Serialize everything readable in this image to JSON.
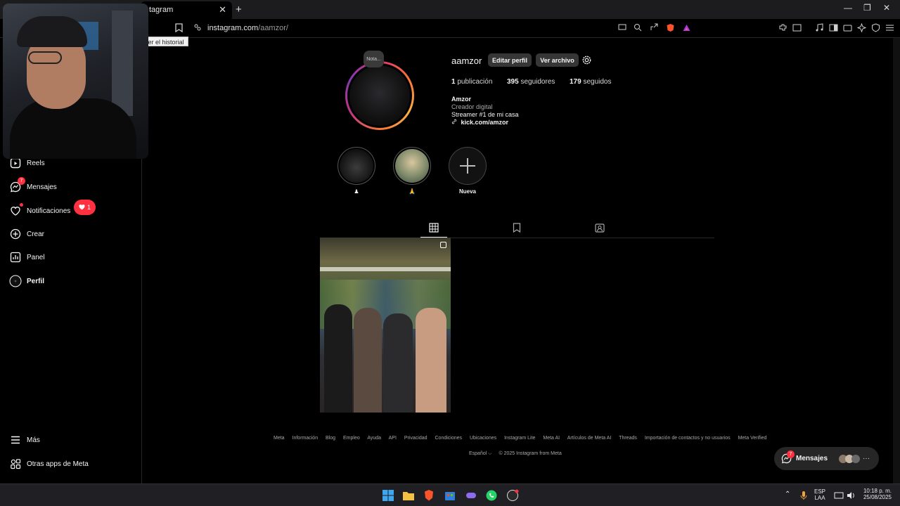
{
  "browser": {
    "tab_title": "tagram",
    "tab_close": "✕",
    "new_tab": "+",
    "url_host": "instagram.com",
    "url_path": "/aamzor/",
    "tooltip": "ver el historial",
    "window_controls": [
      "—",
      "❐",
      "✕"
    ]
  },
  "sidebar": {
    "items": [
      {
        "label": "Reels",
        "icon": "reels-icon"
      },
      {
        "label": "Mensajes",
        "icon": "messenger-icon",
        "badge": "7"
      },
      {
        "label": "Notificaciones",
        "icon": "heart-icon",
        "badge_count": "1"
      },
      {
        "label": "Crear",
        "icon": "plus-square-icon"
      },
      {
        "label": "Panel",
        "icon": "chart-icon"
      },
      {
        "label": "Perfil",
        "icon": "avatar-icon"
      },
      {
        "label": "Más",
        "icon": "menu-icon"
      },
      {
        "label": "Otras apps de Meta",
        "icon": "meta-apps-icon"
      }
    ]
  },
  "profile": {
    "note": "Nota...",
    "username": "aamzor",
    "edit_button": "Editar perfil",
    "archive_button": "Ver archivo",
    "stats": [
      {
        "count": "1",
        "label": "publicación"
      },
      {
        "count": "395",
        "label": "seguidores"
      },
      {
        "count": "179",
        "label": "seguidos"
      }
    ],
    "bio_name": "Amzor",
    "bio_category": "Creador digital",
    "bio_text": "Streamer #1 de mi casa",
    "bio_link": "kick.com/amzor",
    "highlights": [
      {
        "label": "♟"
      },
      {
        "label": "🙏"
      },
      {
        "label": "Nueva"
      }
    ]
  },
  "footer": {
    "links": [
      "Meta",
      "Información",
      "Blog",
      "Empleo",
      "Ayuda",
      "API",
      "Privacidad",
      "Condiciones",
      "Ubicaciones",
      "Instagram Lite",
      "Meta AI",
      "Artículos de Meta AI",
      "Threads",
      "Importación de contactos y no usuarios",
      "Meta Verified"
    ],
    "language": "Español",
    "copyright": "© 2025 Instagram from Meta"
  },
  "messages_pill": {
    "label": "Mensajes",
    "badge": "7"
  },
  "taskbar": {
    "lang_top": "ESP",
    "lang_bottom": "LAA",
    "time": "10:18 p. m.",
    "date": "25/08/2025"
  },
  "colors": {
    "badge_red": "#ff3040",
    "button_gray": "#363636",
    "muted_text": "#a8a8a8"
  }
}
